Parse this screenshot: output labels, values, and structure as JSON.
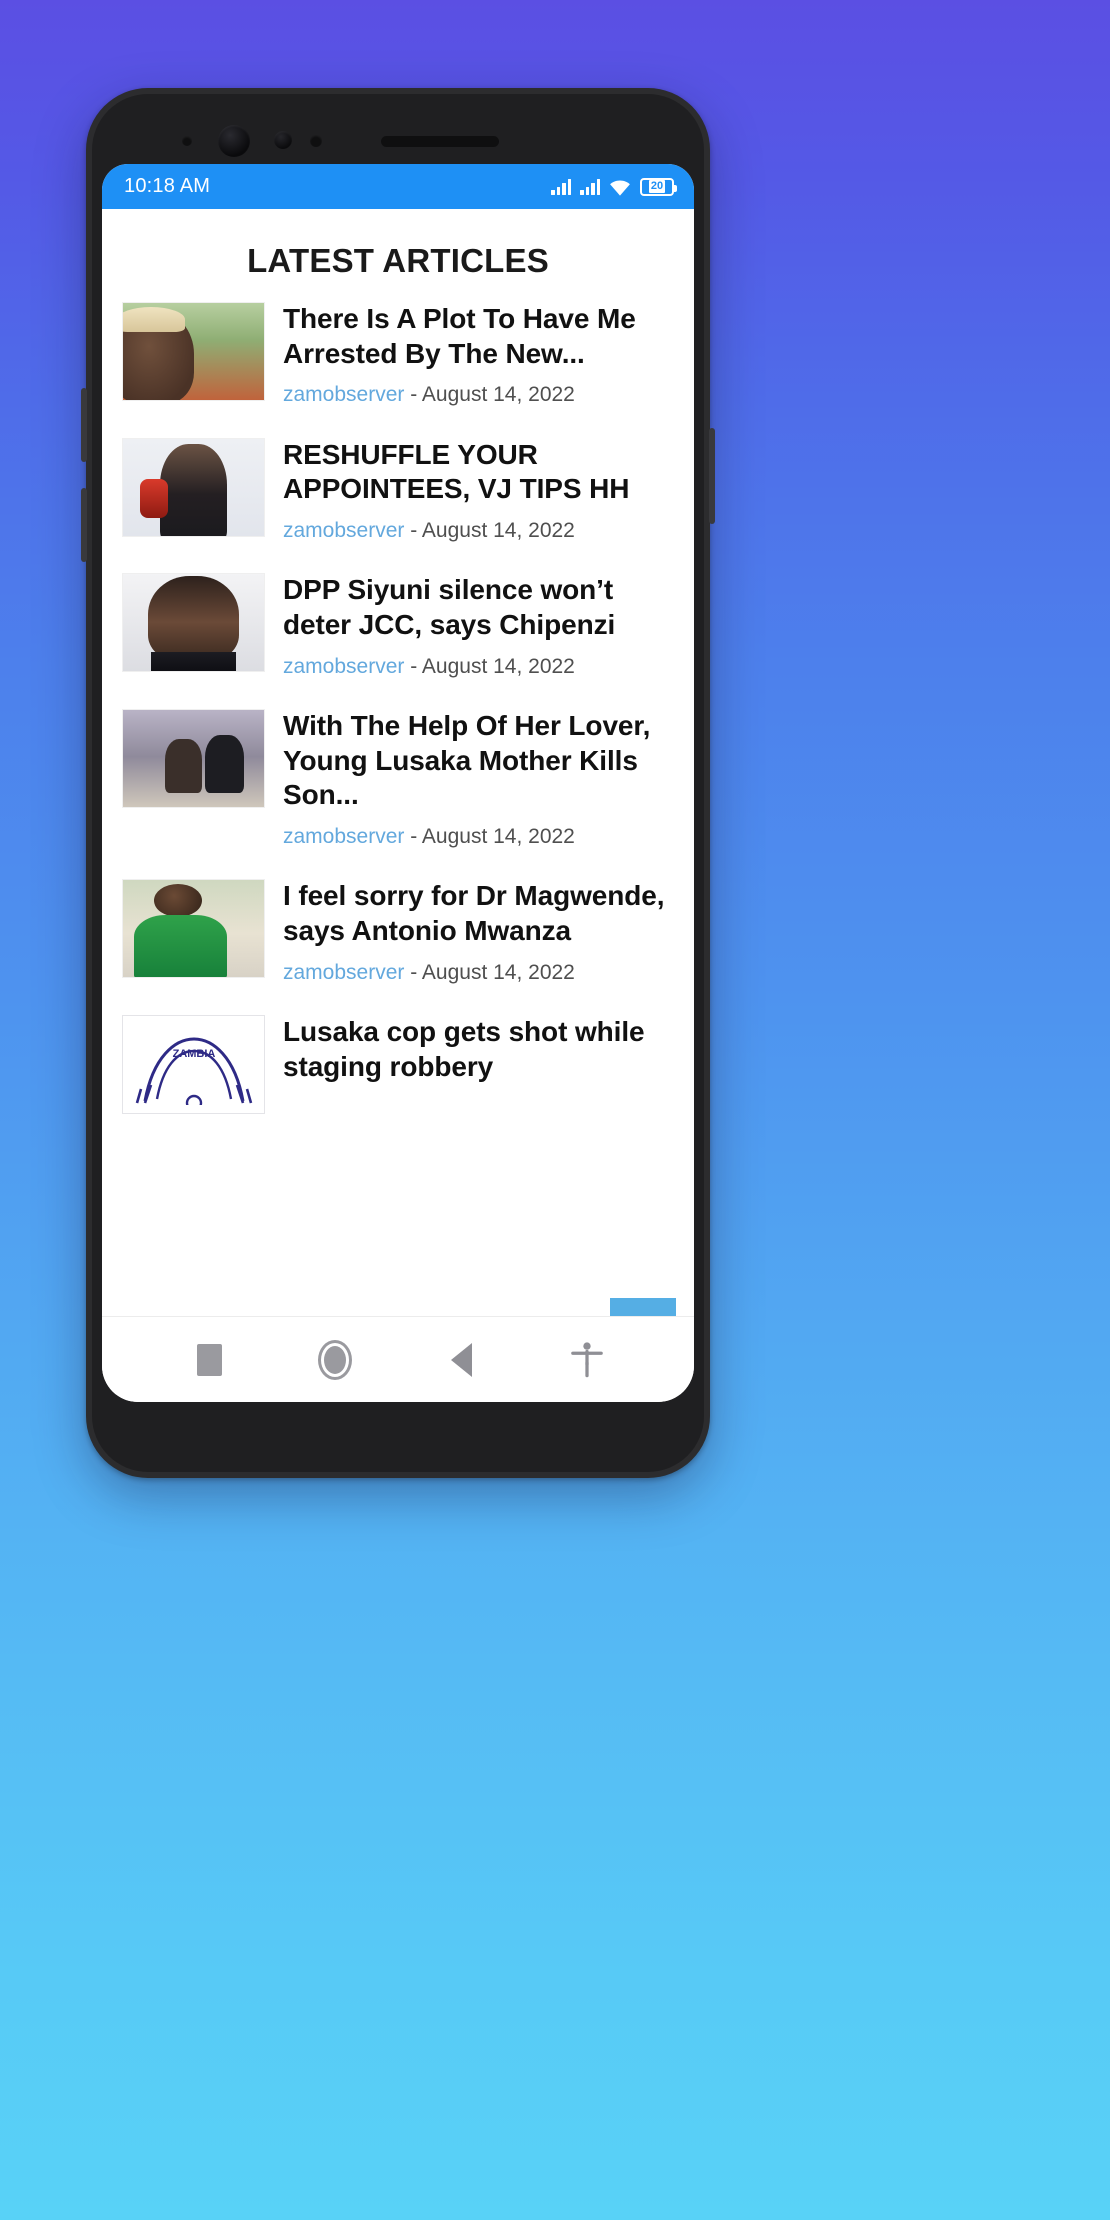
{
  "status_bar": {
    "time": "10:18 AM",
    "battery_level": "20",
    "signal_1_icon": "cellular-signal-icon",
    "signal_2_icon": "cellular-signal-icon",
    "wifi_icon": "wifi-icon",
    "battery_icon": "battery-icon"
  },
  "app": {
    "title": "LATEST ARTICLES"
  },
  "articles": [
    {
      "title": "There Is A Plot To Have Me Arrested By The New...",
      "author": "zamobserver",
      "separator": " - ",
      "date": "August 14, 2022",
      "thumb_name": "article-thumbnail-man-in-hat"
    },
    {
      "title": "RESHUFFLE YOUR APPOINTEES, VJ TIPS HH",
      "author": "zamobserver",
      "separator": " - ",
      "date": "August 14, 2022",
      "thumb_name": "article-thumbnail-man-at-microphone"
    },
    {
      "title": "DPP Siyuni silence won’t deter JCC, says Chipenzi",
      "author": "zamobserver",
      "separator": " - ",
      "date": "August 14, 2022",
      "thumb_name": "article-thumbnail-woman-with-glasses"
    },
    {
      "title": "With The Help Of Her Lover, Young Lusaka Mother Kills Son...",
      "author": "zamobserver",
      "separator": " - ",
      "date": "August 14, 2022",
      "thumb_name": "article-thumbnail-two-people-seated"
    },
    {
      "title": "I feel sorry for Dr Magwende, says Antonio Mwanza",
      "author": "zamobserver",
      "separator": " - ",
      "date": "August 14, 2022",
      "thumb_name": "article-thumbnail-man-in-green-jacket"
    },
    {
      "title": "Lusaka cop gets shot while staging robbery",
      "author": "",
      "separator": "",
      "date": "",
      "thumb_name": "article-thumbnail-zambia-crest",
      "crest_text": "ZAMBIA"
    }
  ],
  "scroll_top_button": {
    "icon": "chevron-up-icon",
    "color": "#55aee4"
  },
  "nav_bar": {
    "recents_icon": "square-recents-icon",
    "home_icon": "circle-home-icon",
    "back_icon": "triangle-back-icon",
    "accessibility_icon": "accessibility-icon"
  },
  "theme": {
    "background_gradient_top": "#5b4fe3",
    "background_gradient_bottom": "#58d2f7",
    "status_bar_color": "#1e90f5",
    "author_link_color": "#63a8dd",
    "title_color": "#111111"
  }
}
